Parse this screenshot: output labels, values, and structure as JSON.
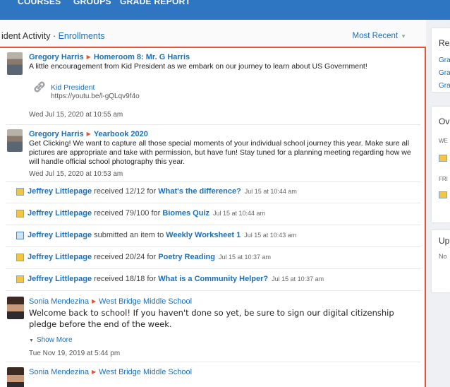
{
  "nav": {
    "items": [
      "COURSES",
      "GROUPS",
      "GRADE REPORT"
    ]
  },
  "header": {
    "title_prefix": "ident Activity · ",
    "title_link": "Enrollments",
    "sort_label": "Most Recent"
  },
  "posts": [
    {
      "author": "Gregory Harris",
      "group": "Homeroom 8: Mr. G Harris",
      "body": "A little encouragement from Kid President as we embark on our journey to learn about US Government!",
      "link_title": "Kid President",
      "link_url": "https://youtu.be/l-gQLqv9f4o",
      "timestamp": "Wed Jul 15, 2020 at 10:55 am"
    },
    {
      "author": "Gregory Harris",
      "group": "Yearbook 2020",
      "body": "Get Clicking! We want to capture all those special moments of your individual school journey this year. Make sure all pictures are appropriate and take with permission, but have fun! Stay tuned for a planning meeting regarding how we will handle official school photography this year.",
      "timestamp": "Wed Jul 15, 2020 at 10:53 am"
    }
  ],
  "activities": [
    {
      "name": "Jeffrey Littlepage",
      "verb": " received 12/12 for ",
      "item": "What's the difference?",
      "when": "Jul 15 at 10:44 am"
    },
    {
      "name": "Jeffrey Littlepage",
      "verb": " received 79/100 for ",
      "item": "Biomes Quiz",
      "when": "Jul 15 at 10:44 am"
    },
    {
      "name": "Jeffrey Littlepage",
      "verb": " submitted an item to ",
      "item": "Weekly Worksheet 1",
      "when": "Jul 15 at 10:43 am"
    },
    {
      "name": "Jeffrey Littlepage",
      "verb": " received 20/24 for ",
      "item": "Poetry Reading",
      "when": "Jul 15 at 10:37 am"
    },
    {
      "name": "Jeffrey Littlepage",
      "verb": " received 18/18 for ",
      "item": "What is a Community Helper?",
      "when": "Jul 15 at 10:37 am"
    }
  ],
  "sonia_post": {
    "author": "Sonia Mendezina",
    "group": "West Bridge Middle School",
    "body": "Welcome back to school! If you haven't done so yet, be sure to sign our digital citizenship pledge before the end of the week.",
    "show_more": "Show More",
    "timestamp": "Tue Nov 19, 2019 at 5:44 pm"
  },
  "sonia_post_2": {
    "author": "Sonia Mendezina",
    "group": "West Bridge Middle School"
  },
  "sidebar": {
    "card1_title": "Re",
    "card1_links": [
      "Gra",
      "Gra",
      "Gra"
    ],
    "card2_title": "Ov",
    "card2_labels": [
      "WE",
      "FRI"
    ],
    "card3_title": "Up",
    "card3_text": "No"
  },
  "colors": {
    "nav": "#2f76c2",
    "link": "#1d6fb8",
    "accent": "#e2563a"
  }
}
